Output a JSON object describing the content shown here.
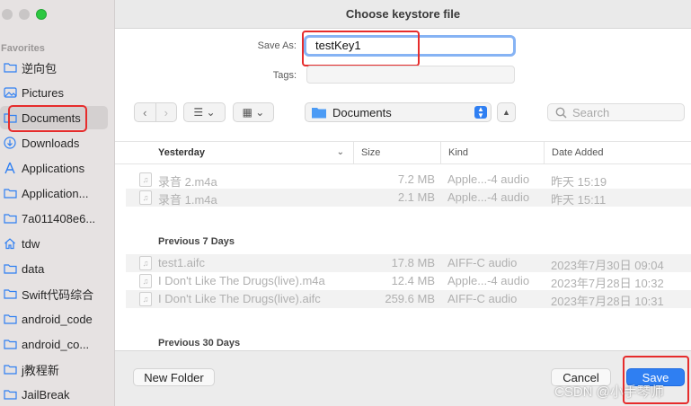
{
  "window": {
    "title": "Choose keystore file"
  },
  "sidebar": {
    "heading": "Favorites",
    "items": [
      {
        "label": "逆向包",
        "icon": "folder-icon"
      },
      {
        "label": "Pictures",
        "icon": "photo-icon"
      },
      {
        "label": "Documents",
        "icon": "document-icon",
        "selected": true
      },
      {
        "label": "Downloads",
        "icon": "download-icon"
      },
      {
        "label": "Applications",
        "icon": "applications-icon"
      },
      {
        "label": "Application...",
        "icon": "folder-icon"
      },
      {
        "label": "7a011408e6...",
        "icon": "folder-icon"
      },
      {
        "label": "tdw",
        "icon": "home-icon"
      },
      {
        "label": "data",
        "icon": "folder-icon"
      },
      {
        "label": "Swift代码综合",
        "icon": "folder-icon"
      },
      {
        "label": "android_code",
        "icon": "folder-icon"
      },
      {
        "label": "android_co...",
        "icon": "folder-icon"
      },
      {
        "label": "j教程新",
        "icon": "folder-icon"
      },
      {
        "label": "JailBreak",
        "icon": "folder-icon"
      }
    ]
  },
  "form": {
    "save_as_label": "Save As:",
    "save_as_value": "testKey1",
    "tags_label": "Tags:"
  },
  "toolbar": {
    "location": "Documents",
    "search_placeholder": "Search"
  },
  "list": {
    "columns": [
      "Yesterday",
      "Size",
      "Kind",
      "Date Added"
    ],
    "sections": [
      {
        "title": "Yesterday",
        "rows": [
          {
            "name": "录音 2.m4a",
            "size": "7.2 MB",
            "kind": "Apple...-4 audio",
            "date": "昨天 15:19"
          },
          {
            "name": "录音 1.m4a",
            "size": "2.1 MB",
            "kind": "Apple...-4 audio",
            "date": "昨天 15:11"
          }
        ]
      },
      {
        "title": "Previous 7 Days",
        "rows": [
          {
            "name": "test1.aifc",
            "size": "17.8 MB",
            "kind": "AIFF-C audio",
            "date": "2023年7月30日 09:04"
          },
          {
            "name": "I Don't Like The Drugs(live).m4a",
            "size": "12.4 MB",
            "kind": "Apple...-4 audio",
            "date": "2023年7月28日 10:32"
          },
          {
            "name": "I Don't Like The Drugs(live).aifc",
            "size": "259.6 MB",
            "kind": "AIFF-C audio",
            "date": "2023年7月28日 10:31"
          }
        ]
      },
      {
        "title": "Previous 30 Days",
        "rows": []
      }
    ]
  },
  "buttons": {
    "new_folder": "New Folder",
    "cancel": "Cancel",
    "save": "Save"
  },
  "watermark": "CSDN @小手琴师",
  "colors": {
    "accent": "#2f7ff2",
    "annotation": "#e62c2c"
  }
}
